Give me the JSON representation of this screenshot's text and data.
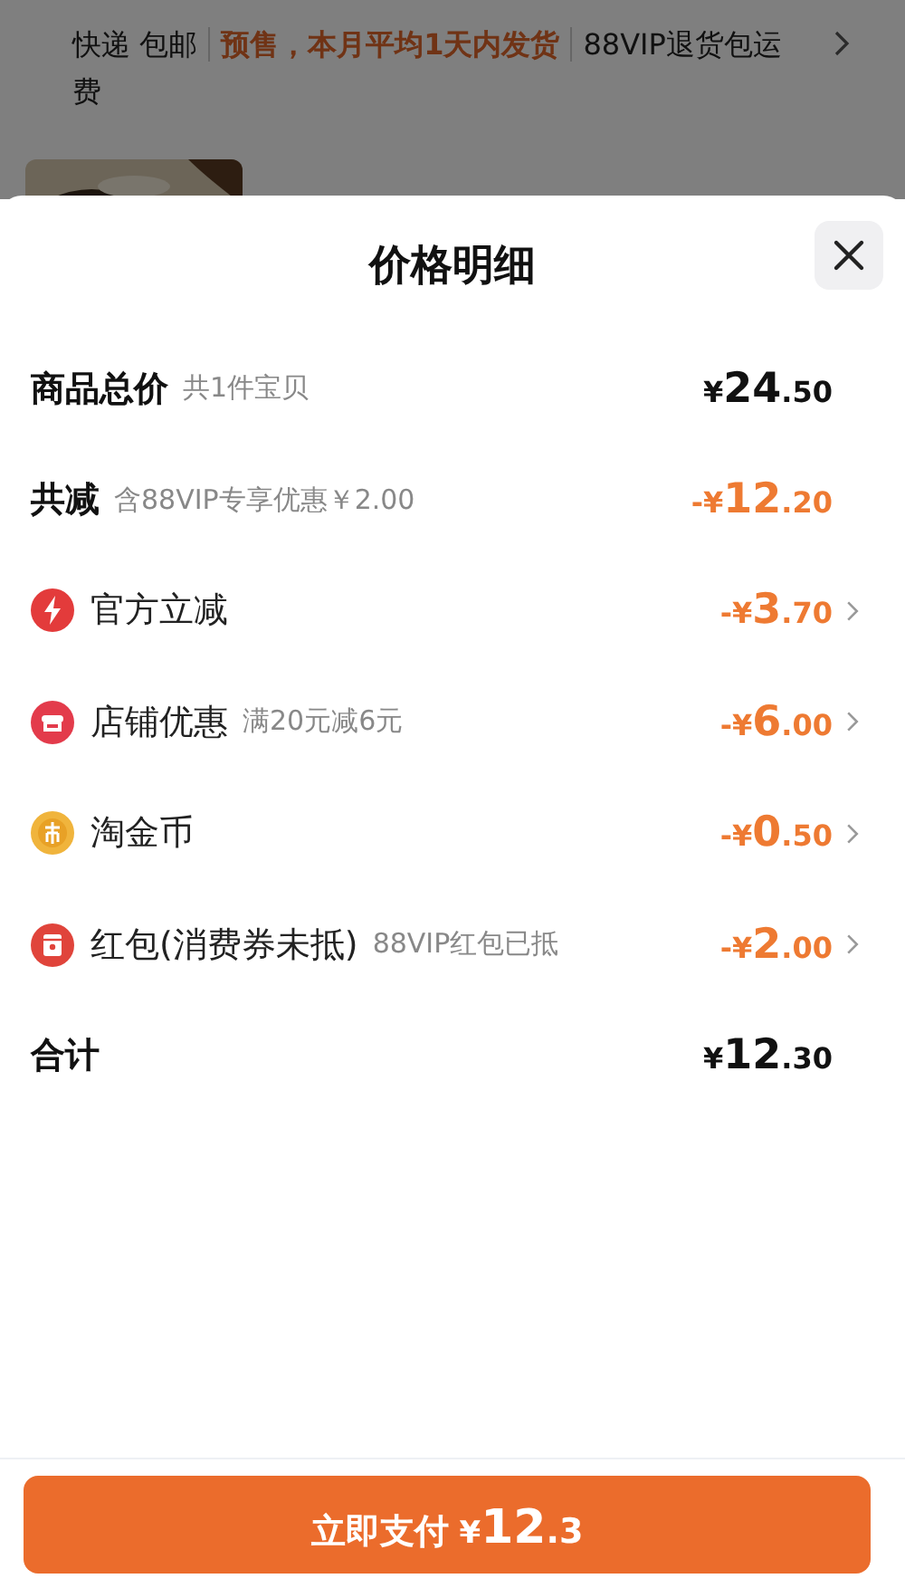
{
  "background": {
    "delivery": [
      {
        "text": "快递 包邮",
        "kind": "plain"
      },
      {
        "text": "预售，本月平均1天内发货",
        "kind": "highlight"
      },
      {
        "text": "88VIP退货包运",
        "kind": "plain"
      },
      {
        "text": "费",
        "kind": "wrapped"
      }
    ]
  },
  "sheet": {
    "title": "价格明细",
    "rows": [
      {
        "kind": "heading",
        "label": "商品总价",
        "note": "共1件宝贝",
        "amount": {
          "prefix": "¥",
          "int": "24",
          "dec": ".50"
        },
        "negative": false
      },
      {
        "kind": "heading",
        "label": "共减",
        "note": "含88VIP专享优惠￥2.00",
        "amount": {
          "prefix": "-¥",
          "int": "12",
          "dec": ".20"
        },
        "negative": true
      },
      {
        "kind": "discount",
        "label": "官方立减",
        "amount": {
          "prefix": "-¥",
          "int": "3",
          "dec": ".70"
        },
        "negative": true
      },
      {
        "kind": "discount",
        "label": "店铺优惠",
        "note": "满20元减6元",
        "amount": {
          "prefix": "-¥",
          "int": "6",
          "dec": ".00"
        },
        "negative": true
      },
      {
        "kind": "discount",
        "label": "淘金币",
        "amount": {
          "prefix": "-¥",
          "int": "0",
          "dec": ".50"
        },
        "negative": true
      },
      {
        "kind": "discount",
        "label": "红包(消费券未抵)",
        "note": "88VIP红包已抵",
        "amount": {
          "prefix": "-¥",
          "int": "2",
          "dec": ".00"
        },
        "negative": true
      },
      {
        "kind": "heading",
        "label": "合计",
        "amount": {
          "prefix": "¥",
          "int": "12",
          "dec": ".30"
        },
        "negative": false
      }
    ],
    "pay_button": {
      "label": "立即支付",
      "amount": {
        "prefix": "¥",
        "int": "12",
        "dec": ".3"
      }
    }
  }
}
